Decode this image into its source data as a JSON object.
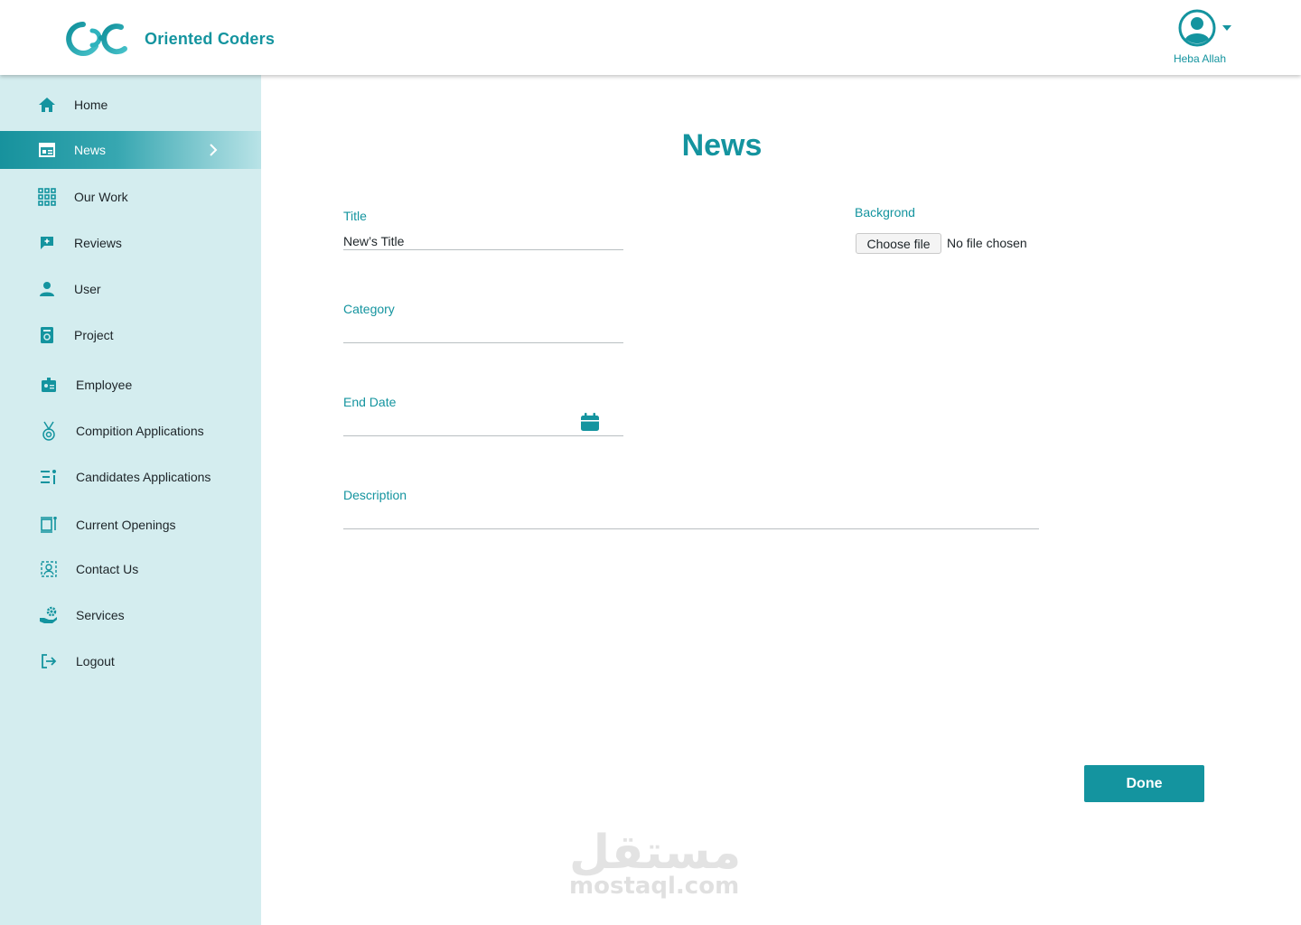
{
  "brand": {
    "name": "Oriented Coders",
    "accent": "#14949f",
    "sidebar_bg": "#d4edef"
  },
  "user": {
    "name": "Heba Allah",
    "icon": "user-circle-icon"
  },
  "sidebar": {
    "items": [
      {
        "label": "Home",
        "icon": "home-icon"
      },
      {
        "label": "News",
        "icon": "news-icon",
        "active": true
      },
      {
        "label": "Our Work",
        "icon": "grid-icon"
      },
      {
        "label": "Reviews",
        "icon": "review-icon"
      },
      {
        "label": "User",
        "icon": "user-icon"
      },
      {
        "label": "Project",
        "icon": "project-icon"
      },
      {
        "label": "Employee",
        "icon": "employee-badge-icon"
      },
      {
        "label": "Compition Applications",
        "icon": "medal-icon"
      },
      {
        "label": "Candidates Applications",
        "icon": "candidates-list-icon"
      },
      {
        "label": "Current Openings",
        "icon": "openings-icon"
      },
      {
        "label": "Contact Us",
        "icon": "contact-icon"
      },
      {
        "label": "Services",
        "icon": "service-hand-icon"
      },
      {
        "label": "Logout",
        "icon": "logout-icon"
      }
    ]
  },
  "main": {
    "title": "News",
    "form": {
      "title_label": "Title",
      "title_value": "New’s Title",
      "category_label": "Category",
      "category_value": "",
      "end_date_label": "End Date",
      "end_date_value": "",
      "description_label": "Description",
      "description_value": "",
      "background_label": "Backgrond",
      "file_button": "Choose file",
      "file_status": "No file chosen"
    },
    "done_label": "Done"
  },
  "watermark": {
    "arabic": "مستقل",
    "latin": "mostaql.com"
  }
}
